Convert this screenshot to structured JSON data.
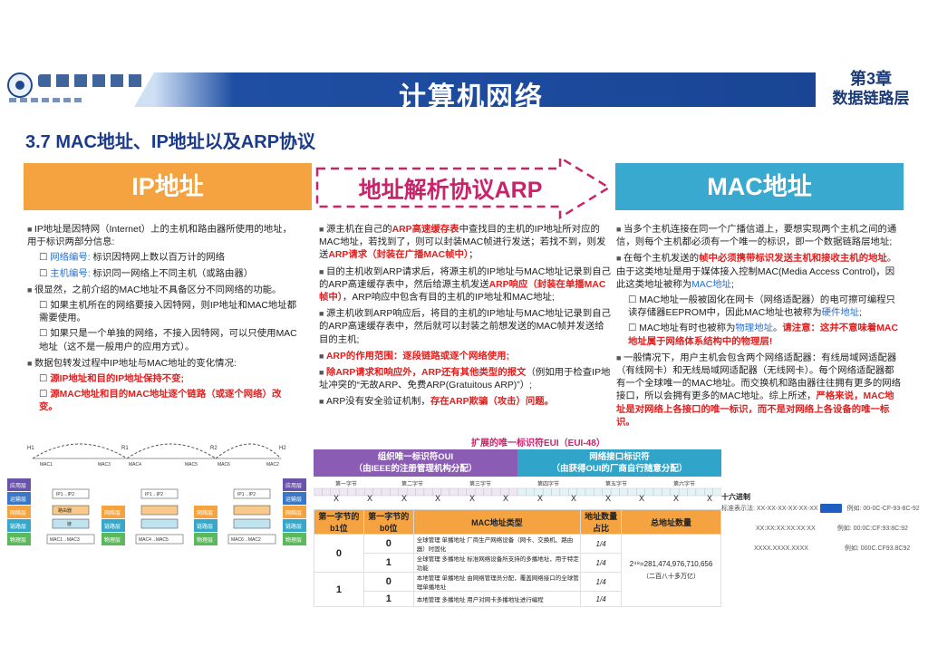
{
  "header": {
    "title": "计算机网络",
    "chapter_num": "第3章",
    "chapter_name": "数据链路层",
    "logo_text": "湖南科技大学"
  },
  "section_title": "3.7 MAC地址、IP地址以及ARP协议",
  "columns": {
    "ip_title": "IP地址",
    "arp_title": "地址解析协议ARP",
    "mac_title": "MAC地址"
  },
  "ip_text": {
    "p1": "IP地址是因特网（Internet）上的主机和路由器所使用的地址，用于标识两部分信息:",
    "p1a_key": "网络编号:",
    "p1a_val": "标识因特网上数以百万计的网络",
    "p1b_key": "主机编号:",
    "p1b_val": "标识同一网络上不同主机（或路由器）",
    "p2": "很显然，之前介绍的MAC地址不具备区分不同网络的功能。",
    "p2a": "如果主机所在的网络要接入因特网，则IP地址和MAC地址都需要使用。",
    "p2b": "如果只是一个单独的网络，不接入因特网，可以只使用MAC地址（这不是一般用户的应用方式）。",
    "p3": "数据包转发过程中IP地址与MAC地址的变化情况:",
    "p3a": "源IP地址和目的IP地址保持不变;",
    "p3b": "源MAC地址和目的MAC地址逐个链路（或逐个网络）改变。"
  },
  "arp_text": {
    "p1a": "源主机在自己的",
    "p1b": "ARP高速缓存表",
    "p1c": "中查找目的主机的IP地址所对应的MAC地址，若找到了，则可以封装MAC帧进行发送；若找不到，则发送",
    "p1d": "ARP请求（封装在广播MAC帧中）",
    "p1e": "；",
    "p2a": "目的主机收到ARP请求后，将源主机的IP地址与MAC地址记录到自己的ARP高速缓存表中，然后给源主机发送",
    "p2b": "ARP响应（封装在单播MAC帧中）",
    "p2c": "，ARP响应中包含有目的主机的IP地址和MAC地址;",
    "p3": "源主机收到ARP响应后，将目的主机的IP地址与MAC地址记录到自己的ARP高速缓存表中，然后就可以封装之前想发送的MAC帧并发送给目的主机;",
    "p4": "ARP的作用范围：逐段链路或逐个网络使用;",
    "p5a": "除ARP请求和响应外，ARP还有其他类型的报文",
    "p5b": "（例如用于检查IP地址冲突的“无故ARP、免费ARP(Gratuitous ARP)”）;",
    "p6a": "ARP没有安全验证机制，",
    "p6b": "存在ARP欺骗（攻击）问题。"
  },
  "mac_text": {
    "p1": "当多个主机连接在同一个广播信道上，要想实现两个主机之间的通信，则每个主机都必须有一个唯一的标识，即一个数据链路层地址;",
    "p2a": "在每个主机发送的",
    "p2b": "帧中必须携带标识发送主机和接收主机的地址",
    "p2c": "。由于这类地址是用于媒体接入控制MAC(Media Access Control)，因此这类地址被称为",
    "p2d": "MAC地址",
    "p2e": ";",
    "p2x": "MAC地址一般被固化在网卡（网络适配器）的电可擦可编程只读存储器EEPROM中，因此MAC地址也被称为",
    "p2x_key": "硬件地址",
    "p2x_end": ";",
    "p2y_a": "MAC地址有时也被称为",
    "p2y_key": "物理地址",
    "p2y_b": "。",
    "p2y_note": "请注意：这并不意味着MAC地址属于网络体系结构中的物理层!",
    "p3a": "一般情况下，用户主机会包含两个网络适配器：有线局域网适配器（有线网卡）和无线局域网适配器（无线网卡）。每个网络适配器都有一个全球唯一的MAC地址。而交换机和路由器往往拥有更多的网络接口，所以会拥有更多的MAC地址。综上所述，",
    "p3b": "严格来说，MAC地址是对网络上各接口的唯一标识，而不是对网络上各设备的唯一标识。"
  },
  "diagram": {
    "h_labels": [
      "H1",
      "R1",
      "R2",
      "H2"
    ],
    "mac_labels": [
      "MAC1",
      "MAC3",
      "MAC4",
      "MAC5",
      "MAC6",
      "MAC2"
    ],
    "ip_labels": [
      "IP1",
      "IP2"
    ],
    "layers_left": [
      "应用层",
      "运输层",
      "网络层",
      "链路层",
      "物理层"
    ],
    "layers_right": [
      "应用层",
      "运输层",
      "网络层",
      "链路层",
      "物理层"
    ],
    "mid_layers": [
      "网络层",
      "链路层",
      "物理层"
    ],
    "route_labels": [
      "IP1→IP2",
      "IP1→IP2",
      "IP1→IP2"
    ],
    "mac_hops": [
      "MAC1→MAC3",
      "MAC4→MAC5",
      "MAC6→MAC2"
    ],
    "router": "路由器",
    "link": "链"
  },
  "oui": {
    "caption": "扩展的唯一标识符EUI（EUI-48）",
    "left": "组织唯一标识符OUI",
    "left_sub": "（由IEEE的注册管理机构分配）",
    "right": "网络接口标识符",
    "right_sub": "（由获得OUI的厂商自行随意分配）",
    "bytes": [
      "第一字节",
      "第二字节",
      "第三字节",
      "第四字节",
      "第五字节",
      "第六字节"
    ],
    "hex_label": "十六进制",
    "x": "X"
  },
  "table": {
    "headers": [
      "第一字节的b1位",
      "第一字节的b0位",
      "MAC地址类型",
      "地址数量占比",
      "总地址数量"
    ],
    "rows": [
      {
        "b1": "0",
        "b0": "0",
        "type": "全球管理 单播地址 厂商生产网络设备（网卡、交换机、路由器）时固化",
        "ratio": "1/4"
      },
      {
        "b1": "",
        "b0": "1",
        "type": "全球管理 多播地址 标准网络设备所支持的多播地址，用于特定功能",
        "ratio": "1/4"
      },
      {
        "b1": "1",
        "b0": "0",
        "type": "本地管理 单播地址 由网络管理员分配，覆盖网络接口的全球管理单播地址",
        "ratio": "1/4"
      },
      {
        "b1": "",
        "b0": "1",
        "type": "本地管理 多播地址 用户对网卡多播地址进行编程",
        "ratio": "1/4"
      }
    ],
    "total": "2⁴⁸=281,474,976,710,656",
    "total_sub": "（二百八十多万亿）"
  },
  "examples": {
    "rows": [
      {
        "left": "标准表示法: XX-XX-XX-XX-XX-XX",
        "right": "例如: 00-0C-CF-93-8C-92"
      },
      {
        "left": "XX:XX:XX:XX:XX:XX",
        "right": "例如: 00:0C:CF:93:8C:92"
      },
      {
        "left": "XXXX.XXXX.XXXX",
        "right": "例如: 000C.CF93.8C92"
      }
    ]
  }
}
